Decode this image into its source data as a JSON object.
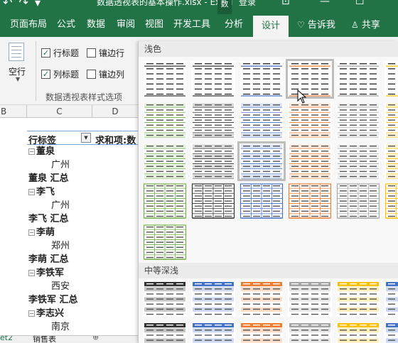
{
  "titlebar": {
    "quick_access": "↶ ↷ ▾",
    "title": "数据透视表的基本操作.xlsx - Excel",
    "tool_context": "数",
    "login": "登录"
  },
  "tabs": [
    {
      "label": "页面布局"
    },
    {
      "label": "公式"
    },
    {
      "label": "数据"
    },
    {
      "label": "审阅"
    },
    {
      "label": "视图"
    },
    {
      "label": "开发工具"
    },
    {
      "label": "分析"
    },
    {
      "label": "设计",
      "active": true
    },
    {
      "label": "告诉我"
    },
    {
      "label": "共享"
    }
  ],
  "ribbon": {
    "blank_rows": "空行",
    "checkboxes": [
      {
        "label": "行标题",
        "checked": true
      },
      {
        "label": "镶边行",
        "checked": false
      },
      {
        "label": "列标题",
        "checked": true
      },
      {
        "label": "镶边列",
        "checked": false
      }
    ],
    "group_label": "数据透视表样式选项"
  },
  "sheet": {
    "columns": [
      "B",
      "C",
      "D"
    ],
    "pivot_header": {
      "row_label": "行标签",
      "sum_label": "求和项:数"
    },
    "rows": [
      {
        "kind": "group",
        "text": "董泉"
      },
      {
        "kind": "city",
        "text": "广州"
      },
      {
        "kind": "sub",
        "text": "董泉 汇总"
      },
      {
        "kind": "group",
        "text": "李飞"
      },
      {
        "kind": "city",
        "text": "广州"
      },
      {
        "kind": "sub",
        "text": "李飞 汇总"
      },
      {
        "kind": "group",
        "text": "李萌"
      },
      {
        "kind": "city",
        "text": "郑州"
      },
      {
        "kind": "sub",
        "text": "李萌 汇总"
      },
      {
        "kind": "group",
        "text": "李铁军"
      },
      {
        "kind": "city",
        "text": "西安"
      },
      {
        "kind": "sub",
        "text": "李铁军 汇总"
      },
      {
        "kind": "group",
        "text": "李志兴"
      },
      {
        "kind": "city",
        "text": "南京"
      }
    ],
    "sheet_tab_left": "et2",
    "sheet_tab": "销售表"
  },
  "gallery": {
    "section_light": "浅色",
    "section_medium": "中等深浅",
    "colors": {
      "black": "#333333",
      "blue": "#4472c4",
      "orange": "#ed7d31",
      "gray": "#a5a5a5",
      "gold": "#ffc000",
      "green": "#70ad47"
    }
  }
}
